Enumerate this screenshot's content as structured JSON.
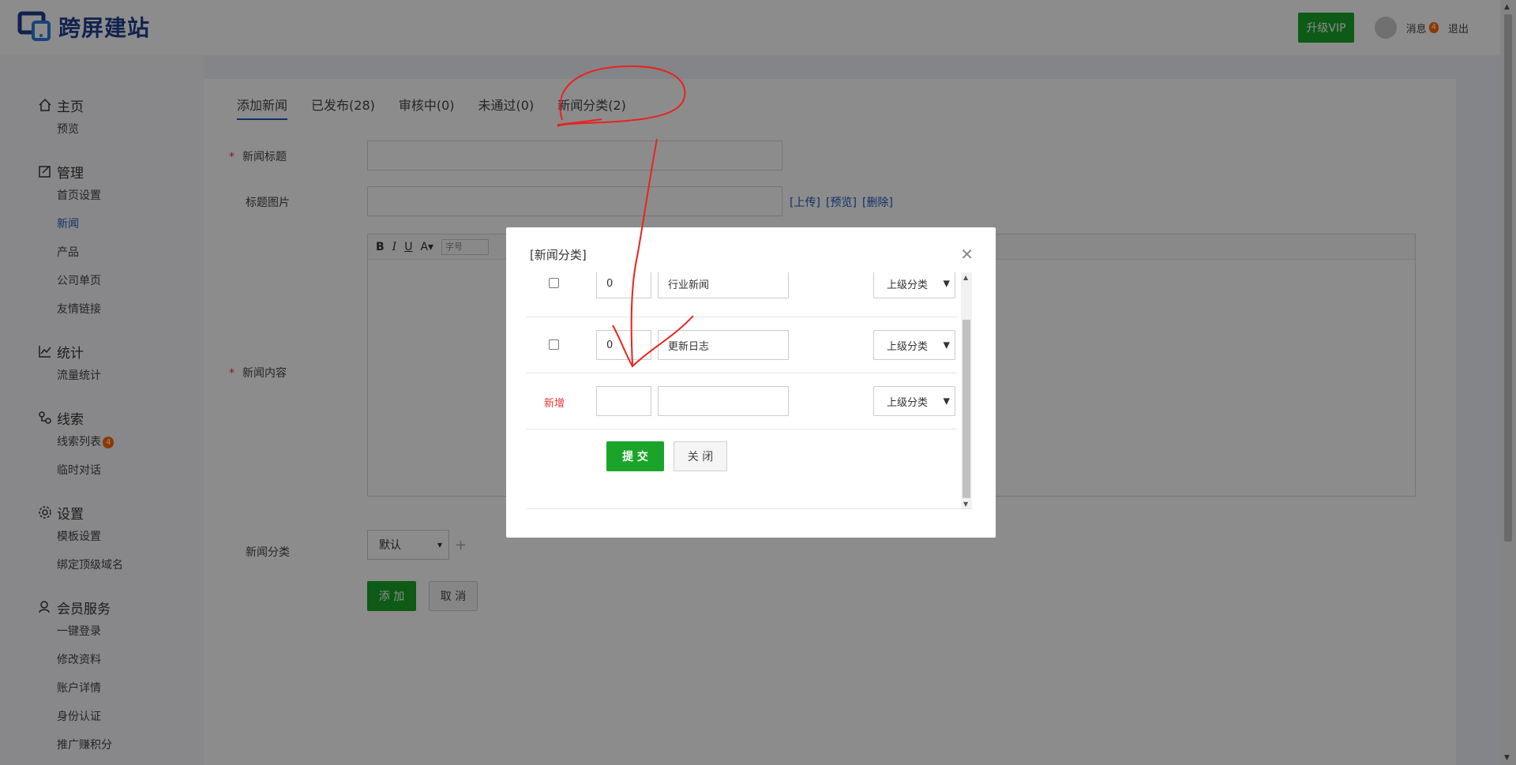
{
  "header": {
    "logo_text": "跨屏建站",
    "vip_label": "升级VIP",
    "messages_label": "消息",
    "messages_count": "4",
    "logout_label": "退出"
  },
  "sidebar": {
    "groups": [
      {
        "title": "主页",
        "icon": "home-icon",
        "items": [
          "预览"
        ]
      },
      {
        "title": "管理",
        "icon": "edit-icon",
        "items": [
          "首页设置",
          "新闻",
          "产品",
          "公司单页",
          "友情链接"
        ]
      },
      {
        "title": "统计",
        "icon": "chart-icon",
        "items": [
          "流量统计"
        ]
      },
      {
        "title": "线索",
        "icon": "clue-icon",
        "items": [
          "线索列表",
          "临时对话"
        ]
      },
      {
        "title": "设置",
        "icon": "gear-icon",
        "items": [
          "模板设置",
          "绑定顶级域名"
        ]
      },
      {
        "title": "会员服务",
        "icon": "user-icon",
        "items": [
          "一键登录",
          "修改资料",
          "账户详情",
          "身份认证",
          "推广赚积分"
        ]
      }
    ],
    "clue_badge": "4"
  },
  "tabs": [
    "添加新闻",
    "已发布(28)",
    "审核中(0)",
    "未通过(0)",
    "新闻分类(2)"
  ],
  "form": {
    "title_label": "新闻标题",
    "image_label": "标题图片",
    "upload_link": "[上传]",
    "preview_link": "[预览]",
    "delete_link": "[删除]",
    "content_label": "新闻内容",
    "editor_font_size_placeholder": "字号",
    "category_label": "新闻分类",
    "category_value": "默认",
    "add_button": "添 加",
    "cancel_button": "取 消"
  },
  "modal": {
    "title": "[新闻分类]",
    "rows": [
      {
        "order": "0",
        "name": "行业新闻",
        "parent": "上级分类"
      },
      {
        "order": "0",
        "name": "更新日志",
        "parent": "上级分类"
      }
    ],
    "new_row_label": "新增",
    "new_row_parent": "上级分类",
    "submit_button": "提 交",
    "close_button": "关 闭"
  },
  "colors": {
    "brand": "#1f3f8f",
    "accent_green": "#1aa52a",
    "link_blue": "#1f5ab8",
    "badge_orange": "#ff6600",
    "annotation_red": "#e8231f"
  }
}
